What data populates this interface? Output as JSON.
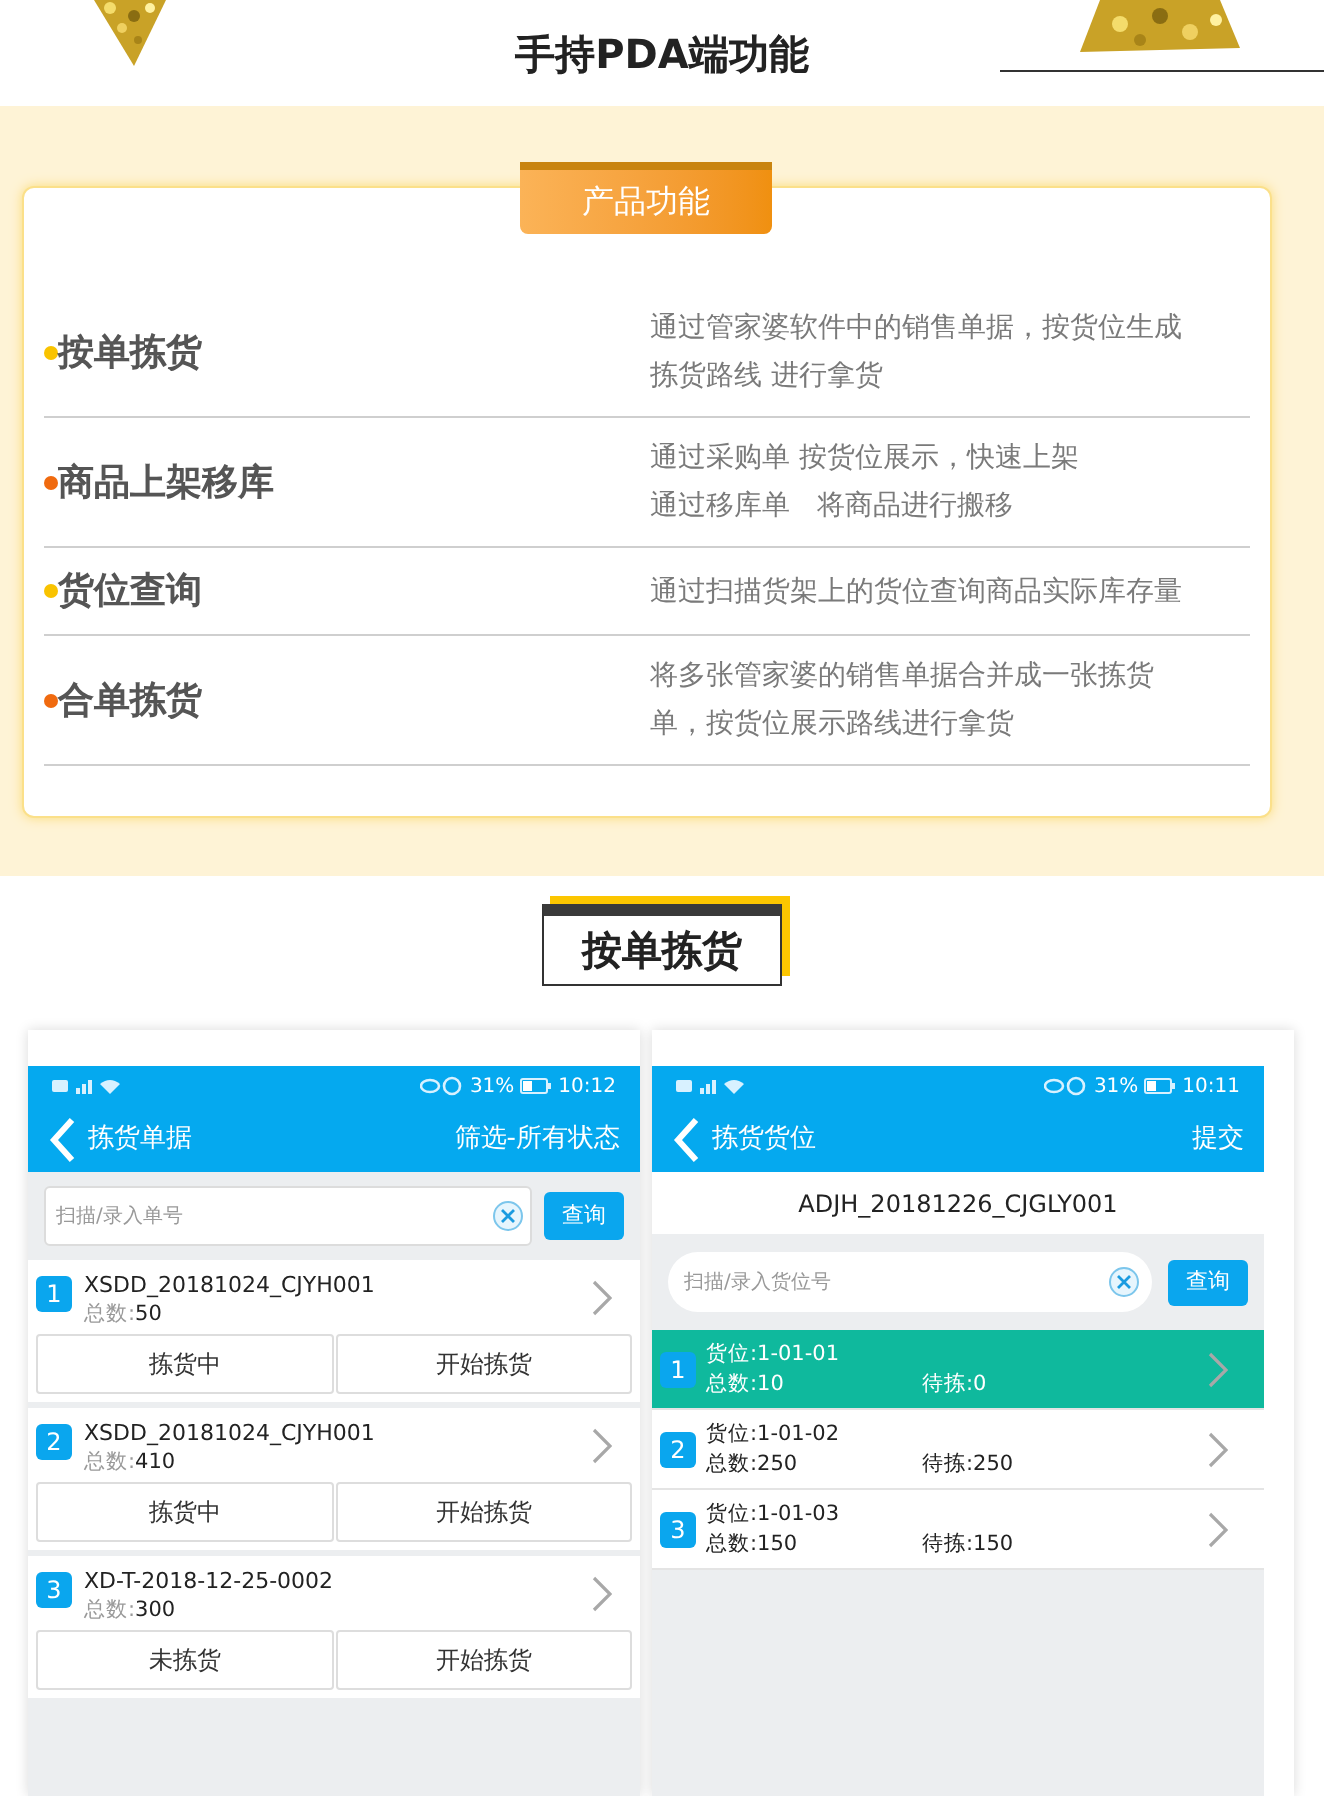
{
  "header": {
    "title": "手持PDA端功能"
  },
  "features": {
    "badge": "产品功能",
    "items": [
      {
        "title": "按单拣货",
        "color": "#f9c300",
        "lines": [
          "通过管家婆软件中的销售单据，按货位生成",
          "拣货路线 进行拿货"
        ]
      },
      {
        "title": "商品上架移库",
        "color": "#f06a0f",
        "lines": [
          "通过采购单 按货位展示，快速上架",
          "通过移库单   将商品进行搬移"
        ]
      },
      {
        "title": "货位查询",
        "color": "#f9c300",
        "lines": [
          "通过扫描货架上的货位查询商品实际库存量"
        ]
      },
      {
        "title": "合单拣货",
        "color": "#f06a0f",
        "lines": [
          "将多张管家婆的销售单据合并成一张拣货",
          "单，按货位展示路线进行拿货"
        ]
      }
    ]
  },
  "section": {
    "title": "按单拣货"
  },
  "screens": [
    {
      "kind": "orders",
      "battery": "31%",
      "time": "10:12",
      "title": "拣货单据",
      "action": "筛选-所有状态",
      "placeholder": "扫描/录入单号",
      "search_button": "查询",
      "orders": [
        {
          "index": "1",
          "code": "XSDD_20181024_CJYH001",
          "total_label": "总数:",
          "total": "50",
          "status": "拣货中",
          "button": "开始拣货"
        },
        {
          "index": "2",
          "code": "XSDD_20181024_CJYH001",
          "total_label": "总数:",
          "total": "410",
          "status": "拣货中",
          "button": "开始拣货"
        },
        {
          "index": "3",
          "code": "XD-T-2018-12-25-0002",
          "total_label": "总数:",
          "total": "300",
          "status": "未拣货",
          "button": "开始拣货"
        }
      ]
    },
    {
      "kind": "locations",
      "battery": "31%",
      "time": "10:11",
      "title": "拣货货位",
      "action": "提交",
      "order_code": "ADJH_20181226_CJGLY001",
      "placeholder": "扫描/录入货位号",
      "search_button": "查询",
      "locations": [
        {
          "index": "1",
          "location": "货位:1-01-01",
          "total": "总数:10",
          "pending": "待拣:0",
          "selected": true
        },
        {
          "index": "2",
          "location": "货位:1-01-02",
          "total": "总数:250",
          "pending": "待拣:250",
          "selected": false
        },
        {
          "index": "3",
          "location": "货位:1-01-03",
          "total": "总数:150",
          "pending": "待拣:150",
          "selected": false
        }
      ]
    }
  ]
}
